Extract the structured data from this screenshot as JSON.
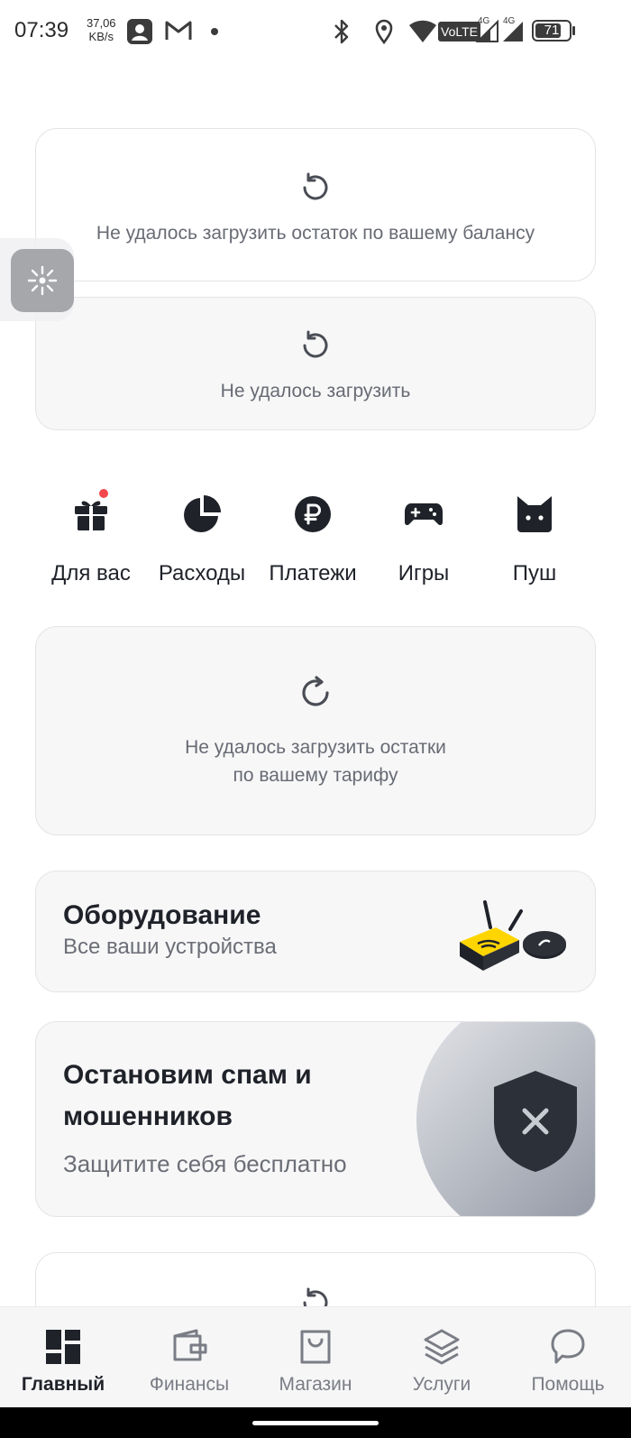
{
  "status_bar": {
    "time": "07:39",
    "speed_value": "37,06",
    "speed_unit": "KB/s",
    "battery": "71",
    "network_labels": [
      "VoLTE",
      "4G",
      "4G"
    ]
  },
  "balance_card": {
    "error_text": "Не удалось загрузить остаток по вашему балансу"
  },
  "second_card": {
    "error_text": "Не удалось загрузить"
  },
  "quick_actions": [
    {
      "label": "Для вас",
      "icon": "gift-icon"
    },
    {
      "label": "Расходы",
      "icon": "pie-chart-icon"
    },
    {
      "label": "Платежи",
      "icon": "ruble-icon"
    },
    {
      "label": "Игры",
      "icon": "gamepad-icon"
    },
    {
      "label": "Пуш",
      "icon": "cat-icon"
    }
  ],
  "tariff_card": {
    "error_line1": "Не удалось загрузить остатки",
    "error_line2": "по вашему тарифу"
  },
  "equipment_card": {
    "title": "Оборудование",
    "subtitle": "Все ваши устройства"
  },
  "spam_card": {
    "title_line1": "Остановим спам и",
    "title_line2": "мошенников",
    "subtitle": "Защитите себя бесплатно"
  },
  "bottom_nav": [
    {
      "label": "Главный",
      "icon": "dashboard-icon",
      "active": true
    },
    {
      "label": "Финансы",
      "icon": "wallet-icon",
      "active": false
    },
    {
      "label": "Магазин",
      "icon": "shopping-bag-icon",
      "active": false
    },
    {
      "label": "Услуги",
      "icon": "layers-icon",
      "active": false
    },
    {
      "label": "Помощь",
      "icon": "chat-bubble-icon",
      "active": false
    }
  ],
  "colors": {
    "accent_yellow": "#ffd500",
    "notification_red": "#f2484d",
    "text_primary": "#1f2229",
    "text_secondary": "#6b6e76"
  }
}
